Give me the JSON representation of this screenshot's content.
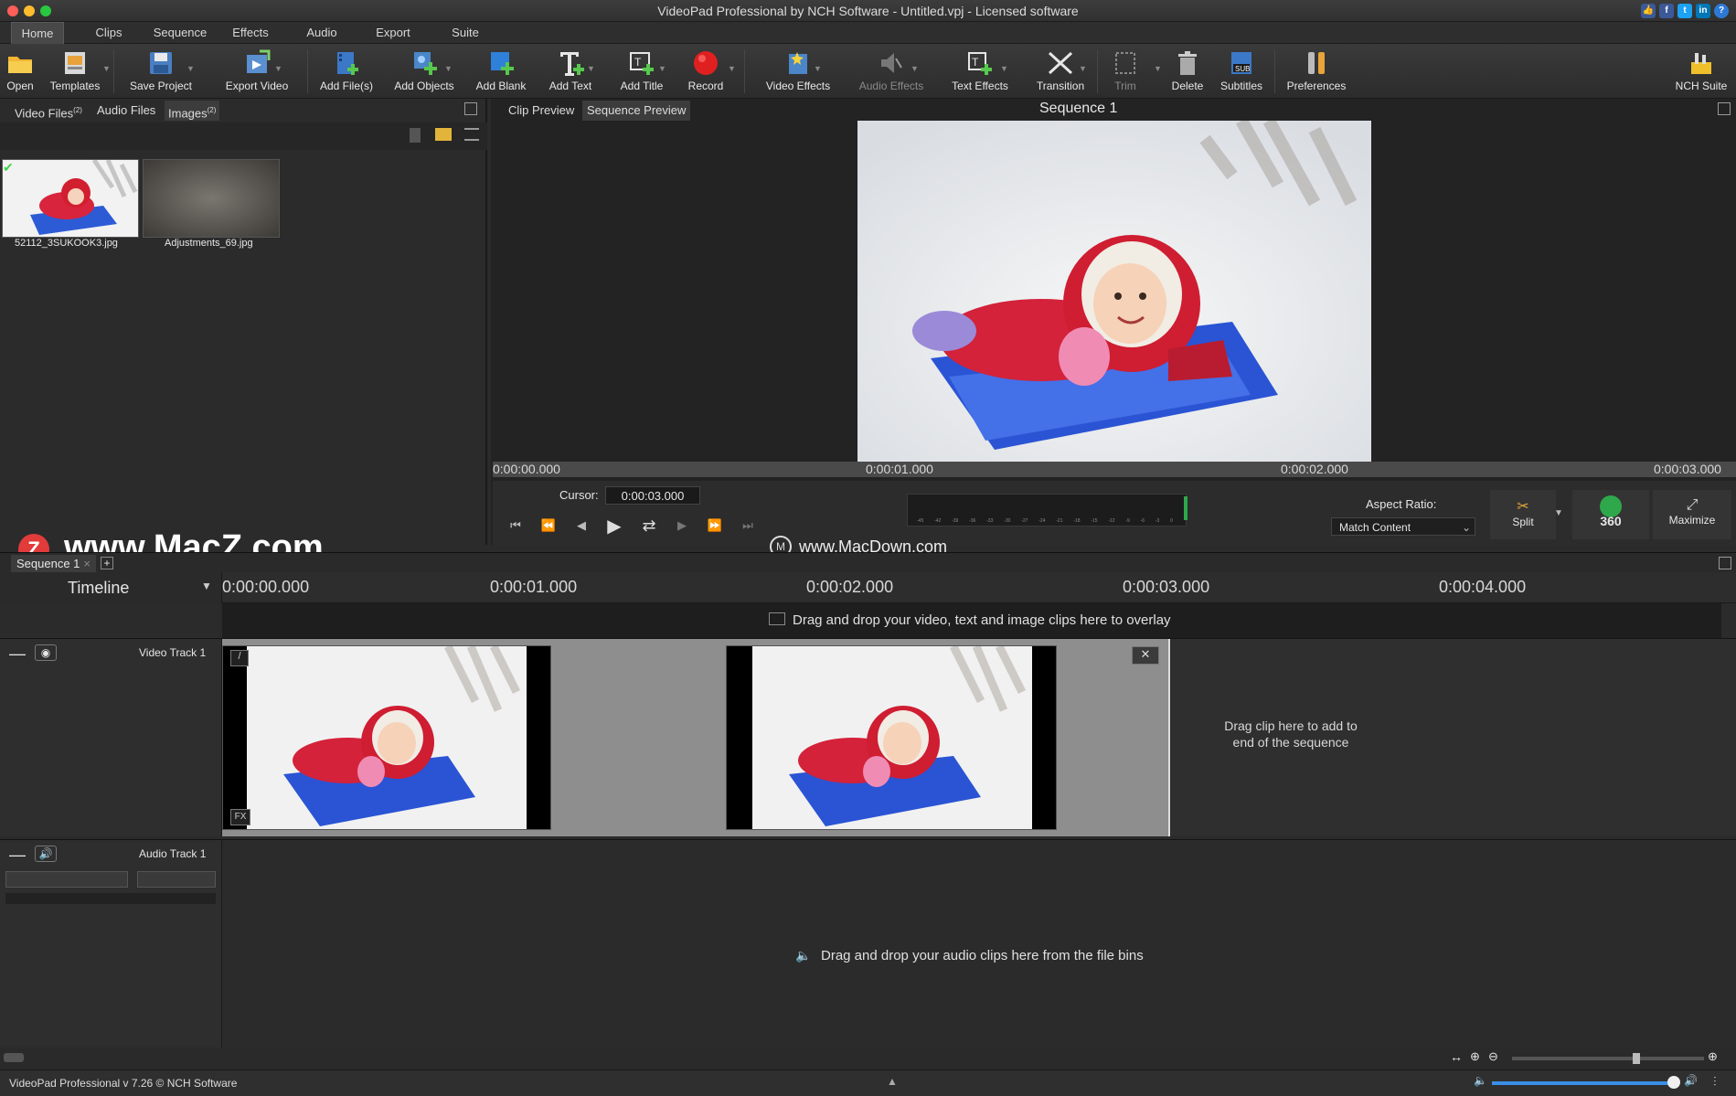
{
  "window": {
    "title": "VideoPad Professional by NCH Software - Untitled.vpj - Licensed software"
  },
  "menu_tabs": [
    "Home",
    "Clips",
    "Sequence",
    "Effects",
    "Audio",
    "Export",
    "Suite"
  ],
  "toolbar": {
    "open": "Open",
    "templates": "Templates",
    "save_project": "Save Project",
    "export_video": "Export Video",
    "add_files": "Add File(s)",
    "add_objects": "Add Objects",
    "add_blank": "Add Blank",
    "add_text": "Add Text",
    "add_title": "Add Title",
    "record": "Record",
    "video_effects": "Video Effects",
    "audio_effects": "Audio Effects",
    "text_effects": "Text Effects",
    "transition": "Transition",
    "trim": "Trim",
    "delete": "Delete",
    "subtitles": "Subtitles",
    "preferences": "Preferences",
    "nch_suite": "NCH Suite"
  },
  "bins": {
    "tabs": [
      {
        "label": "Video Files",
        "count": "(2)"
      },
      {
        "label": "Audio Files",
        "count": ""
      },
      {
        "label": "Images",
        "count": "(2)"
      }
    ],
    "files": [
      {
        "name": "52112_3SUKOOK3.jpg"
      },
      {
        "name": "Adjustments_69.jpg"
      }
    ]
  },
  "preview": {
    "tabs": [
      "Clip Preview",
      "Sequence Preview"
    ],
    "title": "Sequence 1",
    "ruler": [
      "0:00:00.000",
      "0:00:01.000",
      "0:00:02.000",
      "0:00:03.000"
    ],
    "cursor_label": "Cursor:",
    "cursor_value": "0:00:03.000",
    "aspect_label": "Aspect Ratio:",
    "aspect_value": "Match Content",
    "split": "Split",
    "vr360": "360",
    "maximize": "Maximize",
    "meter_scale": [
      "-45",
      "-42",
      "-39",
      "-36",
      "-33",
      "-30",
      "-27",
      "-24",
      "-21",
      "-18",
      "-15",
      "-12",
      "-9",
      "-6",
      "-3",
      "0"
    ]
  },
  "watermarks": {
    "left": "www.MacZ.com",
    "center": "www.MacDown.com"
  },
  "timeline": {
    "sequence_tab": "Sequence 1",
    "label": "Timeline",
    "ruler": [
      "0:00:00.000",
      "0:00:01.000",
      "0:00:02.000",
      "0:00:03.000",
      "0:00:04.000"
    ],
    "overlay_hint": "Drag and drop your video, text and image clips here to overlay",
    "video_track": "Video Track 1",
    "audio_track": "Audio Track 1",
    "end_hint_1": "Drag clip here to add to",
    "end_hint_2": "end of the sequence",
    "audio_hint": "Drag and drop your audio clips here from the file bins",
    "fx": "FX"
  },
  "status": {
    "text": "VideoPad Professional v 7.26 © NCH Software"
  },
  "colors": {
    "accent": "#4a90d9",
    "record": "#e02020",
    "meter_green": "#2ea84a"
  }
}
